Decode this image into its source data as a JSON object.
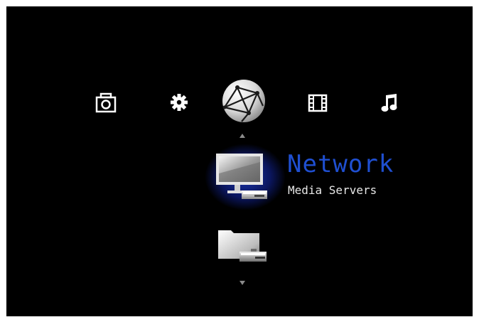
{
  "top_menu": {
    "items": [
      {
        "icon": "camera-icon",
        "id": "photos"
      },
      {
        "icon": "gear-icon",
        "id": "settings"
      },
      {
        "icon": "globe-icon",
        "id": "network",
        "selected": true
      },
      {
        "icon": "film-icon",
        "id": "video"
      },
      {
        "icon": "music-note-icon",
        "id": "music"
      }
    ]
  },
  "sub_menu": {
    "selected_item": {
      "icon": "monitor-network-icon",
      "title": "Network",
      "subtitle": "Media Servers"
    },
    "next_item": {
      "icon": "folder-network-icon"
    }
  },
  "colors": {
    "background": "#000000",
    "accent": "#1f4fd1",
    "text": "#e8e8e8",
    "arrow": "#8a8a8a"
  }
}
